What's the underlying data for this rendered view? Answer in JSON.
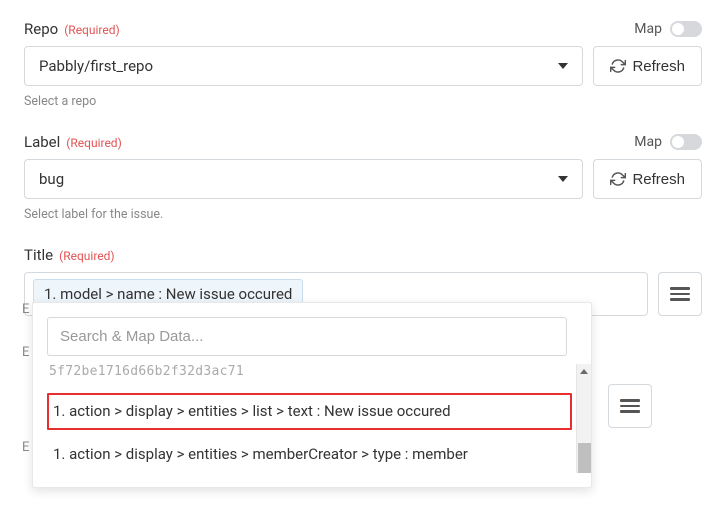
{
  "repo": {
    "label": "Repo",
    "required": "(Required)",
    "map_label": "Map",
    "value": "Pabbly/first_repo",
    "refresh": "Refresh",
    "help": "Select a repo"
  },
  "label_field": {
    "label": "Label",
    "required": "(Required)",
    "map_label": "Map",
    "value": "bug",
    "refresh": "Refresh",
    "help": "Select label for the issue."
  },
  "title_field": {
    "label": "Title",
    "required": "(Required)",
    "chip": "1. model > name : New issue occured"
  },
  "dropdown": {
    "search_placeholder": "Search & Map Data...",
    "truncated": "5f72be1716d66b2f32d3ac71",
    "item1": "1. action > display > entities > list > text : New issue occured",
    "item2": "1. action > display > entities > memberCreator > type : member"
  },
  "letters": {
    "e1": "E",
    "e2": "E",
    "e3": "E"
  }
}
